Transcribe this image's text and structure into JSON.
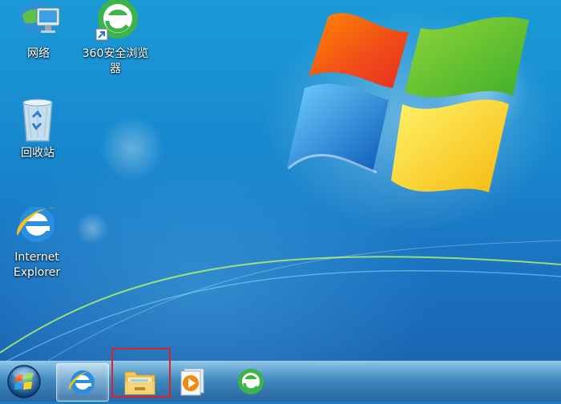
{
  "desktop": {
    "icons": [
      {
        "label": "网络",
        "icon": "network-icon"
      },
      {
        "label": "360安全浏览器",
        "icon": "360-browser-icon"
      },
      {
        "label": "回收站",
        "icon": "recycle-bin-icon"
      },
      {
        "label": "Internet Explorer",
        "icon": "internet-explorer-icon"
      }
    ]
  },
  "taskbar": {
    "start": {
      "icon": "windows-start-orb-icon"
    },
    "pinned": [
      {
        "name": "Internet Explorer",
        "icon": "internet-explorer-icon",
        "active": true
      },
      {
        "name": "Windows Explorer",
        "icon": "folder-icon",
        "highlighted": true
      },
      {
        "name": "Windows Media Player",
        "icon": "media-player-icon"
      },
      {
        "name": "360安全浏览器",
        "icon": "360-browser-icon"
      }
    ]
  },
  "colors": {
    "highlight_border": "#e0202a",
    "ie_blue": "#2a8fe0",
    "browser_green": "#3cb44a"
  }
}
